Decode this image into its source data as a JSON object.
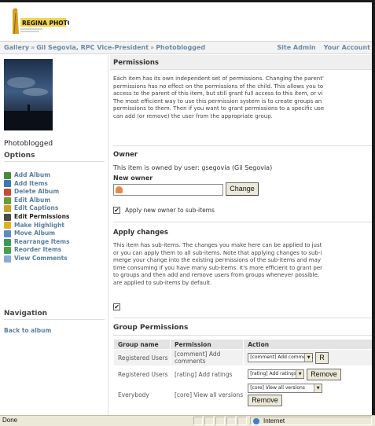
{
  "brand": {
    "logo_text": "REGINA PHOTO CLUB"
  },
  "breadcrumb": {
    "items": [
      "Gallery",
      "Gil Segovia, RPC Vice-President",
      "Photoblogged"
    ],
    "links": [
      "Site Admin",
      "Your Account"
    ]
  },
  "sidebar": {
    "album_caption": "Photoblogged",
    "options_heading": "Options",
    "options": [
      {
        "label": "Add Album",
        "icon": "add-album-icon",
        "color": "#4a8a3a"
      },
      {
        "label": "Add Items",
        "icon": "add-items-icon",
        "color": "#3a78b8"
      },
      {
        "label": "Delete Album",
        "icon": "delete-album-icon",
        "color": "#c94a3a"
      },
      {
        "label": "Edit Album",
        "icon": "edit-album-icon",
        "color": "#6a9a3a"
      },
      {
        "label": "Edit Captions",
        "icon": "edit-captions-icon",
        "color": "#c8a030"
      },
      {
        "label": "Edit Permissions",
        "icon": "edit-permissions-icon",
        "color": "#4a4a4a",
        "current": true
      },
      {
        "label": "Make Highlight",
        "icon": "make-highlight-icon",
        "color": "#e0b020"
      },
      {
        "label": "Move Album",
        "icon": "move-album-icon",
        "color": "#5a8ac8"
      },
      {
        "label": "Rearrange Items",
        "icon": "rearrange-items-icon",
        "color": "#3a9a5a"
      },
      {
        "label": "Reorder Items",
        "icon": "reorder-items-icon",
        "color": "#4aa04a"
      },
      {
        "label": "View Comments",
        "icon": "view-comments-icon",
        "color": "#8aaad8"
      }
    ],
    "navigation_heading": "Navigation",
    "back_link": "Back to album"
  },
  "permissions": {
    "title": "Permissions",
    "description": [
      "Each item has its own independent set of permissions. Changing the parent'",
      "permissions has no effect on the permissions of the child. This allows you to",
      "access to the parent of this item, but still grant full access to this item, or vi",
      "The most efficient way to use this permission system is to create groups an",
      "permissions to them. Then if you want to grant permissions to a specific use",
      "can add (or remove) the user from the appropriate group."
    ]
  },
  "owner": {
    "heading": "Owner",
    "owned_by": "This item is owned by user: gsegovia (Gil Segovia)",
    "new_owner_label": "New owner",
    "input_value": "",
    "change_button": "Change",
    "apply_sub_label": "Apply new owner to sub-items",
    "apply_sub_checked": true
  },
  "apply_changes": {
    "heading": "Apply changes",
    "description": [
      "This item has sub-items. The changes you make here can be applied to just",
      "or you can apply them to all sub-items. Note that applying changes to sub-i",
      "merge your change into the existing permissions of the sub-items and may",
      "time consuming if you have many sub-items. It's more efficient to grant per",
      "to groups and then add and remove users from groups whenever possible.",
      "are applied to sub-items by default."
    ],
    "checked": true
  },
  "group_permissions": {
    "heading": "Group Permissions",
    "columns": [
      "Group name",
      "Permission",
      "Action"
    ],
    "rows": [
      {
        "group": "Registered Users",
        "permission": "[comment] Add comments",
        "select": "[comment] Add comments",
        "button": "R"
      },
      {
        "group": "Registered Users",
        "permission": "[rating] Add ratings",
        "select": "[rating] Add ratings",
        "button": "Remove"
      },
      {
        "group": "Everybody",
        "permission": "[core] View all versions",
        "select": "[core] View all versions",
        "button": "Remove"
      }
    ]
  },
  "statusbar": {
    "status": "Done",
    "zone": "Internet"
  }
}
